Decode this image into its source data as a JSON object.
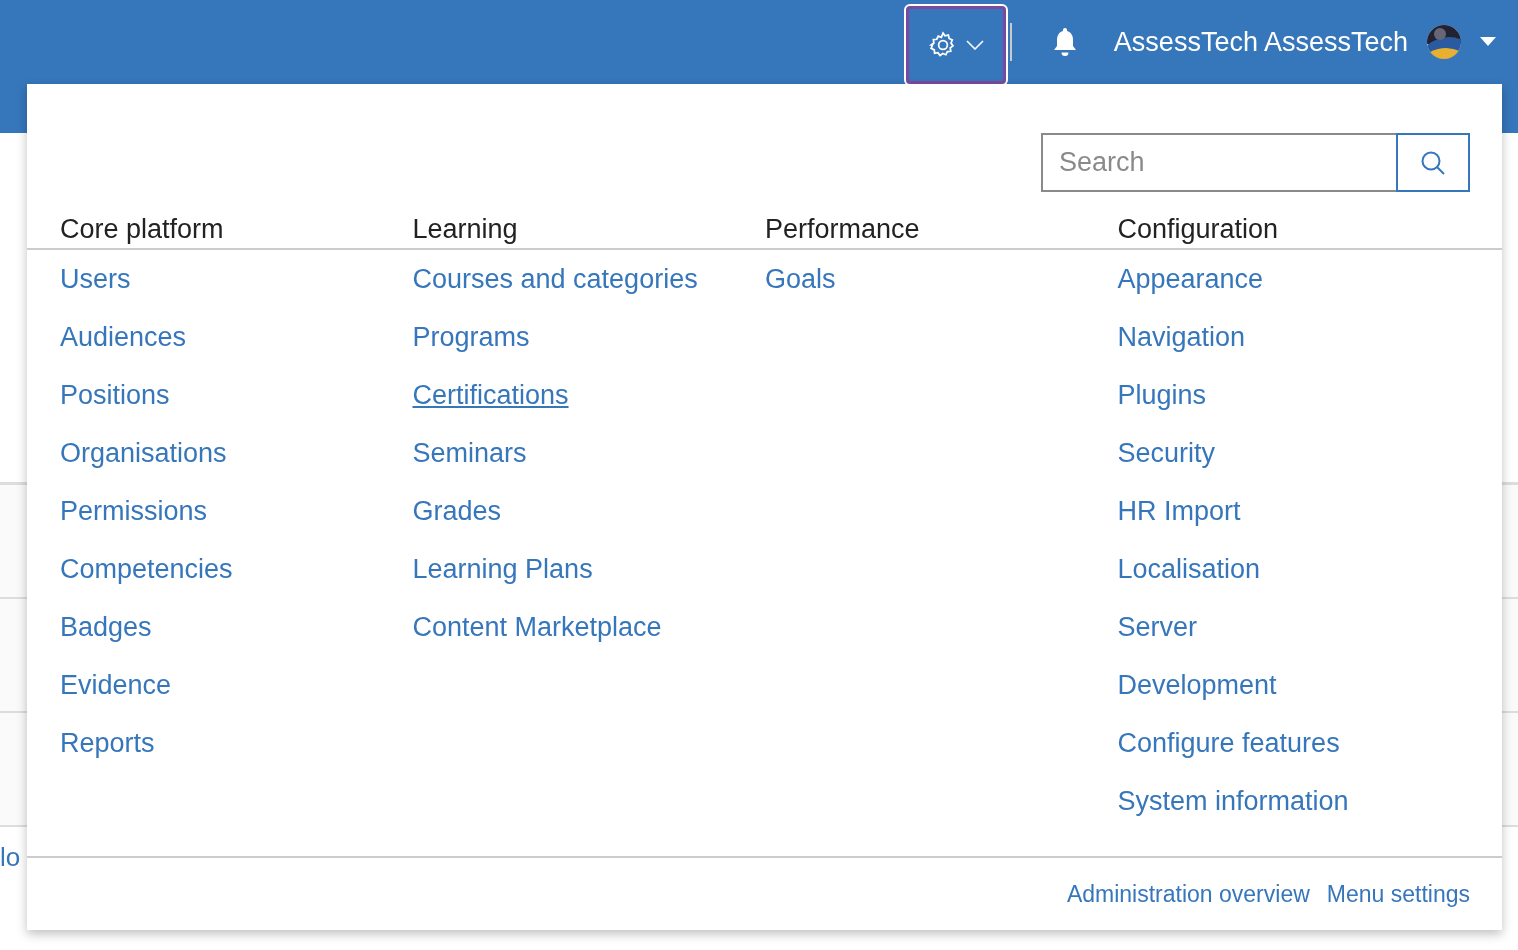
{
  "top_bar": {
    "settings_button": {
      "selected": true
    },
    "user_name": "AssessTech AssessTech"
  },
  "background_page": {
    "row_text": "lo"
  },
  "admin_menu": {
    "search": {
      "placeholder": "Search"
    },
    "columns": [
      {
        "heading": "Core platform",
        "items": [
          {
            "label": "Users",
            "hovered": false
          },
          {
            "label": "Audiences",
            "hovered": false
          },
          {
            "label": "Positions",
            "hovered": false
          },
          {
            "label": "Organisations",
            "hovered": false
          },
          {
            "label": "Permissions",
            "hovered": false
          },
          {
            "label": "Competencies",
            "hovered": false
          },
          {
            "label": "Badges",
            "hovered": false
          },
          {
            "label": "Evidence",
            "hovered": false
          },
          {
            "label": "Reports",
            "hovered": false
          }
        ]
      },
      {
        "heading": "Learning",
        "items": [
          {
            "label": "Courses and categories",
            "hovered": false
          },
          {
            "label": "Programs",
            "hovered": false
          },
          {
            "label": "Certifications",
            "hovered": true
          },
          {
            "label": "Seminars",
            "hovered": false
          },
          {
            "label": "Grades",
            "hovered": false
          },
          {
            "label": "Learning Plans",
            "hovered": false
          },
          {
            "label": "Content Marketplace",
            "hovered": false
          }
        ]
      },
      {
        "heading": "Performance",
        "items": [
          {
            "label": "Goals",
            "hovered": false
          }
        ]
      },
      {
        "heading": "Configuration",
        "items": [
          {
            "label": "Appearance",
            "hovered": false
          },
          {
            "label": "Navigation",
            "hovered": false
          },
          {
            "label": "Plugins",
            "hovered": false
          },
          {
            "label": "Security",
            "hovered": false
          },
          {
            "label": "HR Import",
            "hovered": false
          },
          {
            "label": "Localisation",
            "hovered": false
          },
          {
            "label": "Server",
            "hovered": false
          },
          {
            "label": "Development",
            "hovered": false
          },
          {
            "label": "Configure features",
            "hovered": false
          },
          {
            "label": "System information",
            "hovered": false
          }
        ]
      }
    ],
    "footer_links": [
      "Administration overview",
      "Menu settings"
    ]
  }
}
